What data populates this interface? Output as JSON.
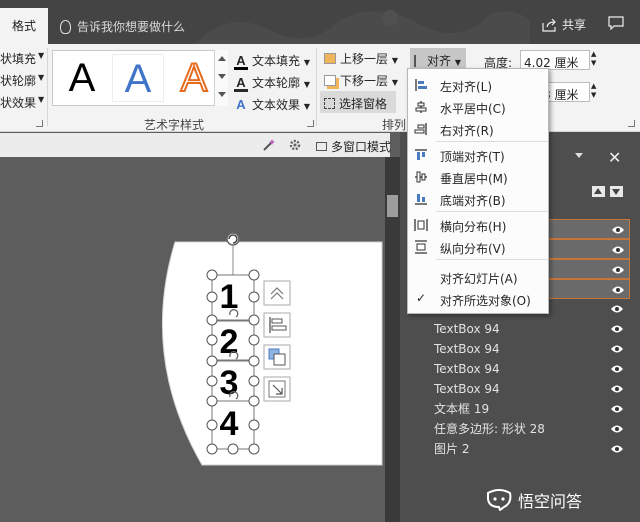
{
  "titlebar": {
    "active_tab": "格式",
    "tell_me_placeholder": "告诉我你想要做什么",
    "share_label": "共享"
  },
  "ribbon": {
    "left_cut_items": [
      "状填充",
      "状轮廓",
      "状效果"
    ],
    "wordart_styles": [
      "A",
      "A",
      "A"
    ],
    "text_fill": "文本填充",
    "text_outline": "文本轮廓",
    "text_effect": "文本效果",
    "wordart_group_label": "艺术字样式",
    "bring_forward": "上移一层",
    "send_backward": "下移一层",
    "selection_pane": "选择窗格",
    "align_button": "对齐",
    "arrange_group_label": "排列",
    "height_label": "高度:",
    "height_value": "4.02 厘米",
    "width_value": "2.43 厘米",
    "multi_window_mode": "多窗口模式"
  },
  "align_menu": {
    "items": [
      {
        "label": "左对齐(L)",
        "icon": "align-left-icon"
      },
      {
        "label": "水平居中(C)",
        "icon": "align-center-icon"
      },
      {
        "label": "右对齐(R)",
        "icon": "align-right-icon"
      },
      {
        "label": "顶端对齐(T)",
        "icon": "align-top-icon"
      },
      {
        "label": "垂直居中(M)",
        "icon": "align-middle-icon"
      },
      {
        "label": "底端对齐(B)",
        "icon": "align-bottom-icon"
      },
      {
        "label": "横向分布(H)",
        "icon": "distribute-horizontal-icon"
      },
      {
        "label": "纵向分布(V)",
        "icon": "distribute-vertical-icon"
      },
      {
        "label": "对齐幻灯片(A)",
        "icon": ""
      },
      {
        "label": "对齐所选对象(O)",
        "icon": "check-icon",
        "checked": true
      }
    ]
  },
  "slide": {
    "numbers": [
      "1",
      "2",
      "3",
      "4"
    ]
  },
  "selection_pane": {
    "items": [
      {
        "label": "TextBox 94"
      },
      {
        "label": "TextBox 94"
      },
      {
        "label": "TextBox 94"
      },
      {
        "label": "TextBox 94"
      },
      {
        "label": "文本框 19"
      },
      {
        "label": "任意多边形: 形状 28"
      },
      {
        "label": "图片 2"
      }
    ]
  },
  "watermark": {
    "text": "悟空问答"
  },
  "colors": {
    "ribbon_bg": "#f3f3f3",
    "dark_bg": "#444444",
    "pane_bg": "#4e4e4e",
    "canvas_bg": "#5d5d5d",
    "selection_orange": "#c7763a",
    "wordart_blue": "#3f74c9",
    "wordart_orange": "#e56b1f"
  }
}
